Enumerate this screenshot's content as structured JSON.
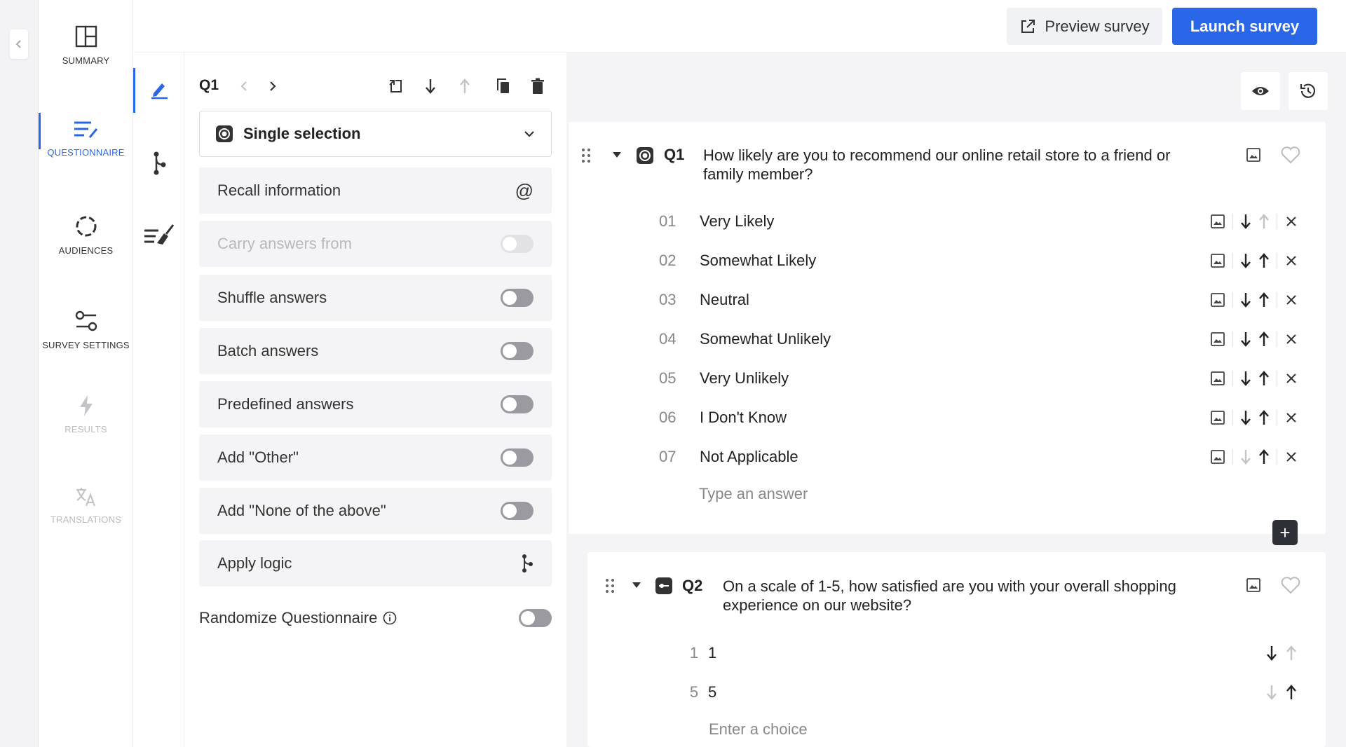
{
  "nav": {
    "items": [
      {
        "label": "SUMMARY",
        "icon": "layout-icon"
      },
      {
        "label": "QUESTIONNAIRE",
        "icon": "list-edit-icon"
      },
      {
        "label": "AUDIENCES",
        "icon": "audience-circle-icon"
      },
      {
        "label": "SURVEY SETTINGS",
        "icon": "sliders-icon"
      },
      {
        "label": "RESULTS",
        "icon": "bolt-icon"
      },
      {
        "label": "TRANSLATIONS",
        "icon": "translate-icon"
      }
    ],
    "active": "QUESTIONNAIRE"
  },
  "topbar": {
    "preview_label": "Preview survey",
    "launch_label": "Launch survey"
  },
  "settings": {
    "question_code": "Q1",
    "question_type": "Single selection",
    "options": [
      {
        "label": "Recall information",
        "control": "at-icon"
      },
      {
        "label": "Carry answers from",
        "control": "toggle",
        "disabled": true
      },
      {
        "label": "Shuffle answers",
        "control": "toggle"
      },
      {
        "label": "Batch answers",
        "control": "toggle"
      },
      {
        "label": "Predefined answers",
        "control": "toggle"
      },
      {
        "label": "Add \"Other\"",
        "control": "toggle"
      },
      {
        "label": "Add \"None of the above\"",
        "control": "toggle"
      },
      {
        "label": "Apply logic",
        "control": "logic-icon"
      }
    ],
    "randomize_label": "Randomize Questionnaire"
  },
  "questions": [
    {
      "code": "Q1",
      "text_line1": "How likely are you to recommend our online retail store to a friend or",
      "text_line2": "family member?",
      "answers": [
        {
          "num": "01",
          "text": "Very Likely"
        },
        {
          "num": "02",
          "text": "Somewhat Likely"
        },
        {
          "num": "03",
          "text": "Neutral"
        },
        {
          "num": "04",
          "text": "Somewhat Unlikely"
        },
        {
          "num": "05",
          "text": "Very Unlikely"
        },
        {
          "num": "06",
          "text": "I Don't Know"
        },
        {
          "num": "07",
          "text": "Not Applicable"
        }
      ],
      "answer_placeholder": "Type an answer"
    },
    {
      "code": "Q2",
      "text_line1": "On a scale of 1-5, how satisfied are you with your overall shopping",
      "text_line2": "experience on our website?",
      "choices": [
        {
          "num": "1",
          "text": "1"
        },
        {
          "num": "5",
          "text": "5"
        }
      ],
      "choice_placeholder": "Enter a choice"
    }
  ],
  "colors": {
    "accent": "#2a67e8",
    "panel_bg": "#f4f4f6",
    "toggle_off": "#9a9aa0"
  }
}
